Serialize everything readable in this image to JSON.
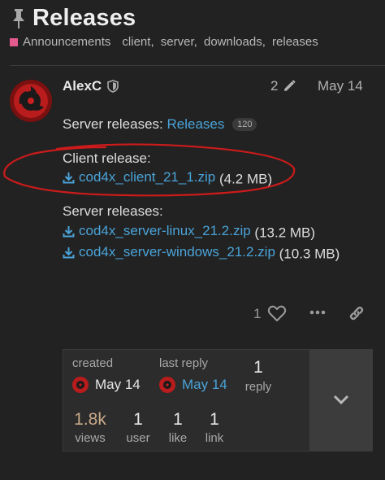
{
  "topic": {
    "title": "Releases",
    "category": "Announcements",
    "category_color": "#e45a8f",
    "tags": [
      "client",
      "server",
      "downloads",
      "releases"
    ]
  },
  "post": {
    "author": "AlexC",
    "edit_count": "2",
    "date": "May 14",
    "server_prefix": "Server releases:",
    "server_link": "Releases",
    "server_link_count": "120",
    "client_heading": "Client release:",
    "client_file": "cod4x_client_21_1.zip",
    "client_size": "(4.2 MB)",
    "server_heading": "Server releases:",
    "server_files": [
      {
        "name": "cod4x_server-linux_21.2.zip",
        "size": "(13.2 MB)"
      },
      {
        "name": "cod4x_server-windows_21.2.zip",
        "size": "(10.3 MB)"
      }
    ],
    "like_count": "1"
  },
  "topic_map": {
    "created_label": "created",
    "created_date": "May 14",
    "last_reply_label": "last reply",
    "last_reply_date": "May 14",
    "replies_num": "1",
    "replies_label": "reply",
    "views_num": "1.8k",
    "views_label": "views",
    "users_num": "1",
    "users_label": "user",
    "likes_num": "1",
    "likes_label": "like",
    "links_num": "1",
    "links_label": "link"
  },
  "colors": {
    "link": "#4aa3d8",
    "views_highlight": "#c9a98a",
    "annotation": "#cc1b1b"
  },
  "icons": [
    "pin-icon",
    "shield-icon",
    "pencil-icon",
    "download-icon",
    "heart-icon",
    "more-icon",
    "link-icon",
    "chevron-down-icon"
  ]
}
